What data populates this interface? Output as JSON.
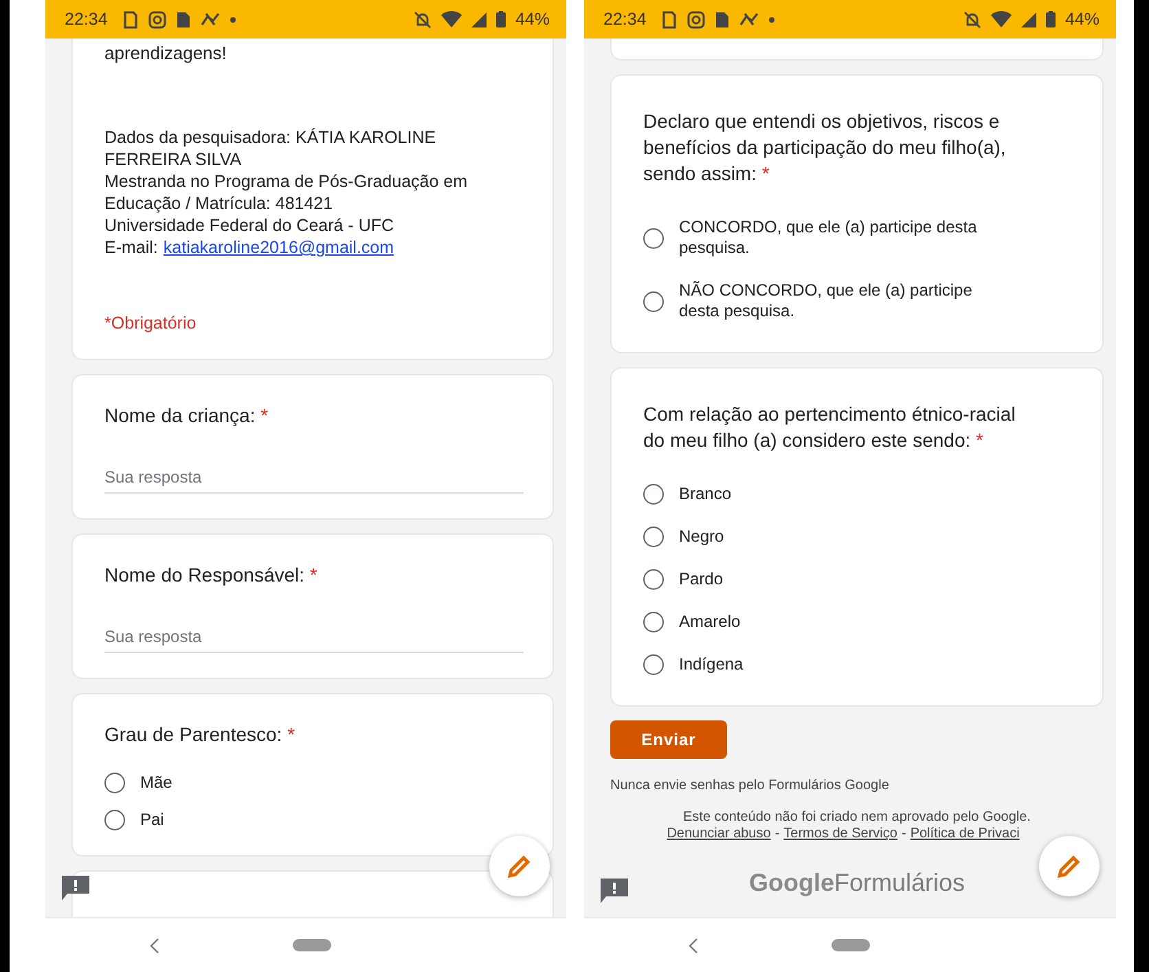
{
  "screens": [
    {
      "status_bar": {
        "time": "22:34",
        "battery": "44%"
      },
      "cards": [
        {
          "kind": "intro",
          "paragraphs": [
            "aprendizagens!"
          ],
          "details": [
            "Dados da pesquisadora: KÁTIA KAROLINE FERREIRA SILVA",
            "Mestranda no Programa de Pós-Graduação em Educação / Matrícula: 481421",
            "Universidade Federal do Ceará - UFC"
          ],
          "email_label": "E-mail:",
          "email": "katiakaroline2016@gmail.com",
          "required_note": "*Obrigatório"
        },
        {
          "kind": "text",
          "title": "Nome da criança:",
          "required_mark": "*",
          "placeholder": "Sua resposta"
        },
        {
          "kind": "text",
          "title": "Nome do Responsável:",
          "required_mark": "*",
          "placeholder": "Sua resposta"
        },
        {
          "kind": "choice",
          "title": "Grau de Parentesco:",
          "required_mark": "*",
          "options": [
            {
              "label": "Mãe",
              "selected": false
            },
            {
              "label": "Pai",
              "selected": false
            }
          ]
        },
        {
          "kind": "stub"
        }
      ]
    },
    {
      "status_bar": {
        "time": "22:34",
        "battery": "44%"
      },
      "cards": [
        {
          "kind": "stub"
        },
        {
          "kind": "choice",
          "title": "Declaro que entendi os objetivos, riscos e benefícios da participação do meu filho(a), sendo assim:",
          "required_mark": "*",
          "options": [
            {
              "label": "CONCORDO, que ele (a) participe desta pesquisa.",
              "selected": false
            },
            {
              "label": "NÃO CONCORDO, que ele (a) participe desta pesquisa.",
              "selected": false
            }
          ]
        },
        {
          "kind": "choice",
          "title": "Com relação ao pertencimento étnico-racial do meu filho (a) considero este sendo:",
          "required_mark": "*",
          "options": [
            {
              "label": "Branco",
              "selected": false
            },
            {
              "label": "Negro",
              "selected": false
            },
            {
              "label": "Pardo",
              "selected": false
            },
            {
              "label": "Amarelo",
              "selected": false
            },
            {
              "label": "Indígena",
              "selected": false
            }
          ]
        }
      ],
      "submit": "Enviar",
      "footer": {
        "notice": "Nunca envie senhas pelo Formulários Google",
        "disclaimer": "Este conteúdo não foi criado nem aprovado pelo Google.",
        "links": [
          "Denunciar abuso",
          "Termos de Serviço",
          "Política de Privaci"
        ],
        "separator": "-",
        "brand": "Google",
        "product": "Formulários"
      }
    }
  ]
}
